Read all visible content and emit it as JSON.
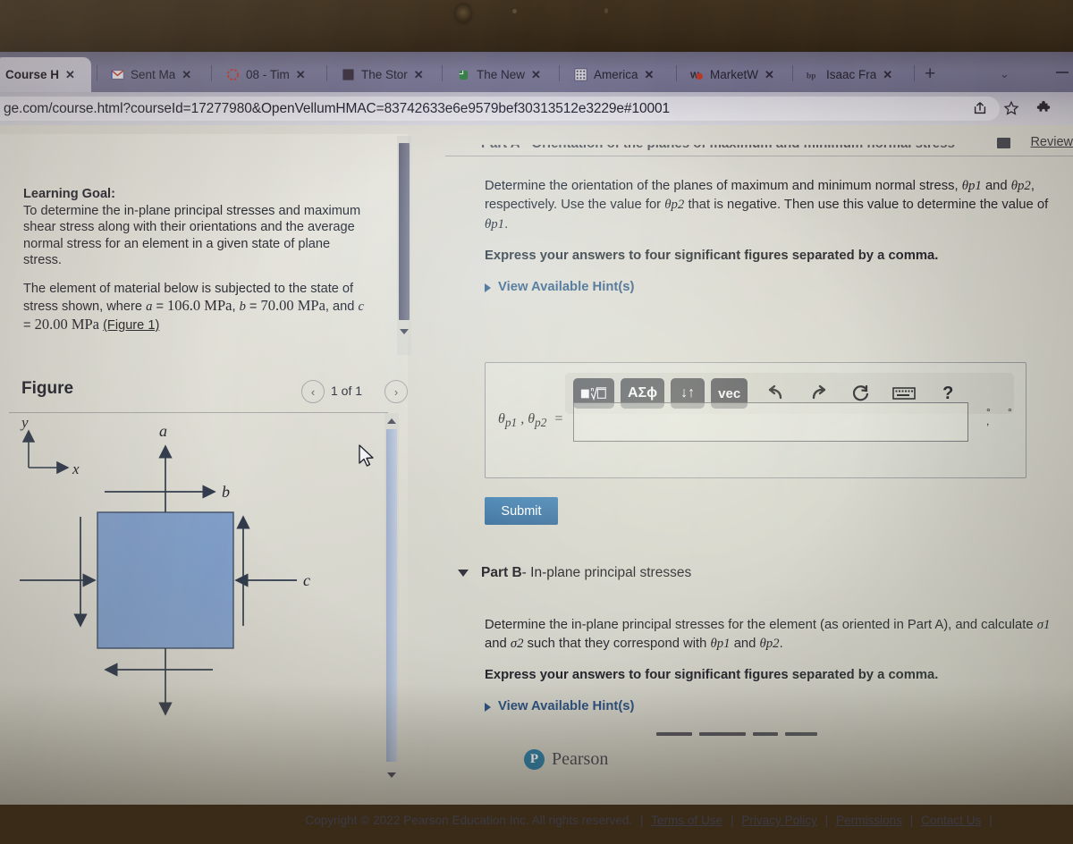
{
  "browser": {
    "tabs": [
      {
        "title": "Course H",
        "icon": "page-icon",
        "active": true
      },
      {
        "title": "Sent Ma",
        "icon": "gmail-icon",
        "active": false
      },
      {
        "title": "08 - Tim",
        "icon": "loading-icon",
        "active": false
      },
      {
        "title": "The Stor",
        "icon": "dark-square-icon",
        "active": false
      },
      {
        "title": "The New",
        "icon": "evernote-icon",
        "active": false
      },
      {
        "title": "America",
        "icon": "grid-icon",
        "active": false
      },
      {
        "title": "MarketW",
        "icon": "marketwatch-icon",
        "active": false
      },
      {
        "title": "Isaac Fra",
        "icon": "bp-icon",
        "active": false
      }
    ],
    "close_glyph": "✕",
    "new_tab_label": "+",
    "tab_list_chevron": "⌄",
    "url": "ge.com/course.html?courseId=17277980&OpenVellumHMAC=83742633e6e9579bef30313512e3229e#10001",
    "url_icons": [
      "share-icon",
      "bookmark-star-icon",
      "extensions-puzzle-icon"
    ]
  },
  "topbar": {
    "review_label": "Review",
    "clipped_heading": "Part A - Orientation of the planes of maximum and minimum normal stress"
  },
  "left_pane": {
    "learning_goal_heading": "Learning Goal:",
    "learning_goal_body": "To determine the in-plane principal stresses and maximum shear stress along with their orientations and the average normal stress for an element in a given state of plane stress.",
    "problem_intro": "The element of material below is subjected to the state of stress shown, where",
    "a_symbol": "a",
    "a_value": "106.0 MPa",
    "b_symbol": "b",
    "b_value": "70.00 MPa",
    "c_symbol": "c",
    "c_value": "20.00 MPa",
    "figure_link": "(Figure 1)",
    "figure_title": "Figure",
    "figure_count": "1 of 1",
    "prev_glyph": "‹",
    "next_glyph": "›",
    "diagram": {
      "axis_y": "y",
      "axis_x": "x",
      "label_a": "a",
      "label_b": "b",
      "label_c": "c",
      "element_fill": "#7d9cc8",
      "element_stroke": "#3b4a63"
    }
  },
  "right_pane": {
    "question_line1": "Determine the orientation of the planes of maximum and minimum normal stress,",
    "theta_p1": "θp1",
    "theta_p2": "θp2",
    "question_line2": "respectively.  Use the value for",
    "question_line3": "that is negative. Then use this value to determine the value of",
    "instruction": "Express your answers to four significant figures separated by a comma.",
    "hint_label": "View Available Hint(s)",
    "answer_label": "θp1 , θp2  =",
    "answer_value": "",
    "units_left": "°",
    "units_comma": ",",
    "units_right": "°",
    "submit_label": "Submit",
    "math_toolbar": [
      {
        "name": "template-radical-button",
        "label": "√"
      },
      {
        "name": "greek-symbols-button",
        "label": "ΑΣϕ"
      },
      {
        "name": "sort-updown-button",
        "label": "↓↑"
      },
      {
        "name": "vector-button",
        "label": "vec"
      },
      {
        "name": "undo-icon",
        "label": "↶"
      },
      {
        "name": "redo-icon",
        "label": "↷"
      },
      {
        "name": "reset-icon",
        "label": "↺"
      },
      {
        "name": "keyboard-icon",
        "label": "⌨"
      },
      {
        "name": "help-icon",
        "label": "?"
      }
    ]
  },
  "part_b": {
    "label": "Part B",
    "dash": "-",
    "title": "In-plane principal stresses",
    "body_line1": "Determine the in-plane principal stresses for the element (as oriented in Part A), and calculate",
    "sigma1": "σ1",
    "body_line2": "and",
    "sigma2": "σ2",
    "body_line3": "such that they correspond with",
    "theta_p1": "θp1",
    "body_and": "and",
    "theta_p2": "θp2",
    "instruction": "Express your answers to four significant figures separated by a comma.",
    "hint_label": "View Available Hint(s)"
  },
  "footer": {
    "brand": "Pearson",
    "brand_mark": "P",
    "copyright": "Copyright © 2022 Pearson Education Inc. All rights reserved.",
    "links": [
      "Terms of Use",
      "Privacy Policy",
      "Permissions",
      "Contact Us"
    ],
    "separator": "|"
  },
  "colors": {
    "accent_blue": "#33699b",
    "link_blue": "#2b4f7e",
    "element_blue": "#7d9cc8",
    "pearson_teal": "#2f7fa8"
  }
}
